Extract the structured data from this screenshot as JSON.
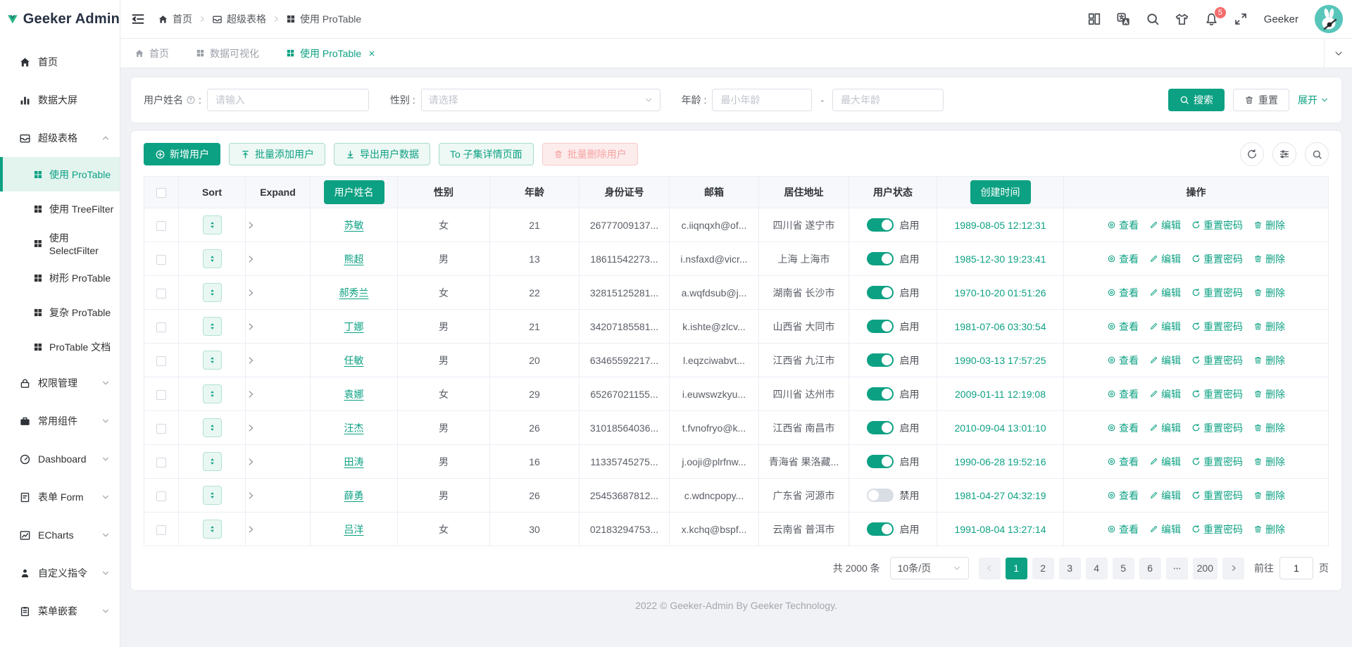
{
  "app": {
    "title": "Geeker Admin",
    "footer": "2022 © Geeker-Admin By Geeker Technology."
  },
  "colors": {
    "primary": "#0da183",
    "badge_red": "#f56c6c",
    "avatar_bg": "#57c5ba"
  },
  "sidebar": {
    "home": "首页",
    "datascreen": "数据大屏",
    "supertable": "超级表格",
    "sub": {
      "protable": "使用 ProTable",
      "treefilter": "使用 TreeFilter",
      "selectfilter": "使用 SelectFilter",
      "treeprotable": "树形 ProTable",
      "complex": "复杂 ProTable",
      "doc": "ProTable 文档"
    },
    "auth": "权限管理",
    "components": "常用组件",
    "dashboard": "Dashboard",
    "form": "表单 Form",
    "echarts": "ECharts",
    "directives": "自定义指令",
    "nestmenu": "菜单嵌套"
  },
  "header": {
    "breadcrumb": {
      "home": "首页",
      "supertable": "超级表格",
      "protable": "使用 ProTable"
    },
    "notification_badge": "5",
    "username": "Geeker"
  },
  "tabs": {
    "home": "首页",
    "dataviz": "数据可视化",
    "protable": "使用 ProTable"
  },
  "search": {
    "name_label": "用户姓名",
    "colon": ":",
    "name_placeholder": "请输入",
    "gender_label": "性别 :",
    "gender_placeholder": "请选择",
    "age_label": "年龄 :",
    "age_min_placeholder": "最小年龄",
    "age_separator": "-",
    "age_max_placeholder": "最大年龄",
    "search_btn": "搜索",
    "reset_btn": "重置",
    "expand_btn": "展开"
  },
  "toolbar": {
    "add": "新增用户",
    "batch_add": "批量添加用户",
    "export": "导出用户数据",
    "to_detail": "To 子集详情页面",
    "batch_delete": "批量删除用户"
  },
  "table": {
    "h": {
      "sort": "Sort",
      "expand": "Expand",
      "name": "用户姓名",
      "gender": "性别",
      "age": "年龄",
      "idcard": "身份证号",
      "email": "邮箱",
      "address": "居住地址",
      "status": "用户状态",
      "created": "创建时间",
      "ops": "操作"
    },
    "actions": {
      "view": "查看",
      "edit": "编辑",
      "reset": "重置密码",
      "del": "删除"
    },
    "rows": [
      {
        "name": "苏敏",
        "gender": "女",
        "age": "21",
        "idcard": "26777009137...",
        "email": "c.iiqnqxh@of...",
        "address": "四川省 遂宁市",
        "enabled": true,
        "status": "启用",
        "created": "1989-08-05 12:12:31"
      },
      {
        "name": "熊超",
        "gender": "男",
        "age": "13",
        "idcard": "18611542273...",
        "email": "i.nsfaxd@vicr...",
        "address": "上海 上海市",
        "enabled": true,
        "status": "启用",
        "created": "1985-12-30 19:23:41"
      },
      {
        "name": "郝秀兰",
        "gender": "女",
        "age": "22",
        "idcard": "32815125281...",
        "email": "a.wqfdsub@j...",
        "address": "湖南省 长沙市",
        "enabled": true,
        "status": "启用",
        "created": "1970-10-20 01:51:26"
      },
      {
        "name": "丁娜",
        "gender": "男",
        "age": "21",
        "idcard": "34207185581...",
        "email": "k.ishte@zlcv...",
        "address": "山西省 大同市",
        "enabled": true,
        "status": "启用",
        "created": "1981-07-06 03:30:54"
      },
      {
        "name": "任敏",
        "gender": "男",
        "age": "20",
        "idcard": "63465592217...",
        "email": "l.eqzciwabvt...",
        "address": "江西省 九江市",
        "enabled": true,
        "status": "启用",
        "created": "1990-03-13 17:57:25"
      },
      {
        "name": "袁娜",
        "gender": "女",
        "age": "29",
        "idcard": "65267021155...",
        "email": "i.euwswzkyu...",
        "address": "四川省 达州市",
        "enabled": true,
        "status": "启用",
        "created": "2009-01-11 12:19:08"
      },
      {
        "name": "汪杰",
        "gender": "男",
        "age": "26",
        "idcard": "31018564036...",
        "email": "t.fvnofryo@k...",
        "address": "江西省 南昌市",
        "enabled": true,
        "status": "启用",
        "created": "2010-09-04 13:01:10"
      },
      {
        "name": "田涛",
        "gender": "男",
        "age": "16",
        "idcard": "11335745275...",
        "email": "j.ooji@plrfnw...",
        "address": "青海省 果洛藏...",
        "enabled": true,
        "status": "启用",
        "created": "1990-06-28 19:52:16"
      },
      {
        "name": "薛勇",
        "gender": "男",
        "age": "26",
        "idcard": "25453687812...",
        "email": "c.wdncpopy...",
        "address": "广东省 河源市",
        "enabled": false,
        "status": "禁用",
        "created": "1981-04-27 04:32:19"
      },
      {
        "name": "吕洋",
        "gender": "女",
        "age": "30",
        "idcard": "02183294753...",
        "email": "x.kchq@bspf...",
        "address": "云南省 普洱市",
        "enabled": true,
        "status": "启用",
        "created": "1991-08-04 13:27:14"
      }
    ]
  },
  "pagination": {
    "total": "共 2000 条",
    "page_size": "10条/页",
    "pages": [
      "1",
      "2",
      "3",
      "4",
      "5",
      "6"
    ],
    "last_page": "200",
    "goto_label": "前往",
    "goto_value": "1",
    "unit": "页"
  }
}
